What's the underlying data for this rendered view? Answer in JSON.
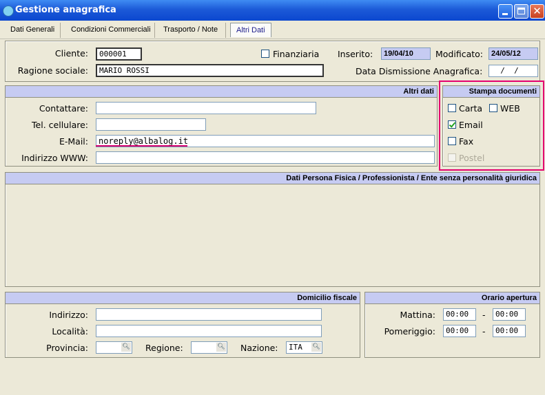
{
  "window": {
    "title": "Gestione anagrafica"
  },
  "tabs": [
    {
      "label": "Dati Generali"
    },
    {
      "label": "Condizioni Commerciali"
    },
    {
      "label": "Trasporto / Note"
    },
    {
      "label": "Altri Dati"
    }
  ],
  "header": {
    "cliente_label": "Cliente:",
    "cliente_value": "000001",
    "finanziaria_label": "Finanziaria",
    "finanziaria_checked": false,
    "inserito_label": "Inserito:",
    "inserito_value": "19/04/10",
    "modificato_label": "Modificato:",
    "modificato_value": "24/05/12",
    "ragione_label": "Ragione sociale:",
    "ragione_value": "MARIO ROSSI",
    "dismissione_label": "Data Dismissione Anagrafica:",
    "dismissione_value": "  /  /"
  },
  "altri_dati": {
    "title": "Altri dati",
    "contattare_label": "Contattare:",
    "contattare_value": "",
    "cellulare_label": "Tel. cellulare:",
    "cellulare_value": "",
    "email_label": "E-Mail:",
    "email_value": "noreply@albalog.it",
    "www_label": "Indirizzo WWW:",
    "www_value": ""
  },
  "stampa": {
    "title": "Stampa documenti",
    "carta_label": "Carta",
    "web_label": "WEB",
    "email_label": "Email",
    "fax_label": "Fax",
    "postel_label": "Postel",
    "carta_checked": false,
    "web_checked": false,
    "email_checked": true,
    "fax_checked": false,
    "postel_enabled": false
  },
  "persona": {
    "title": "Dati Persona Fisica / Professionista / Ente senza personalità giuridica"
  },
  "domicilio": {
    "title": "Domicilio fiscale",
    "indirizzo_label": "Indirizzo:",
    "indirizzo_value": "",
    "localita_label": "Località:",
    "localita_value": "",
    "provincia_label": "Provincia:",
    "provincia_value": "",
    "regione_label": "Regione:",
    "regione_value": "",
    "nazione_label": "Nazione:",
    "nazione_value": "ITA"
  },
  "orario": {
    "title": "Orario apertura",
    "mattina_label": "Mattina:",
    "mattina_from": "00:00",
    "mattina_to": "00:00",
    "pomeriggio_label": "Pomeriggio:",
    "pomeriggio_from": "00:00",
    "pomeriggio_to": "00:00",
    "separator": "-"
  },
  "colors": {
    "header_blue": "#c6cbf2",
    "highlight": "#e4006e",
    "titlebar": "#0b47cf"
  },
  "icons": {
    "app": "app-icon",
    "minimize": "minimize-icon",
    "maximize": "maximize-icon",
    "close": "close-icon",
    "search": "search-icon"
  }
}
